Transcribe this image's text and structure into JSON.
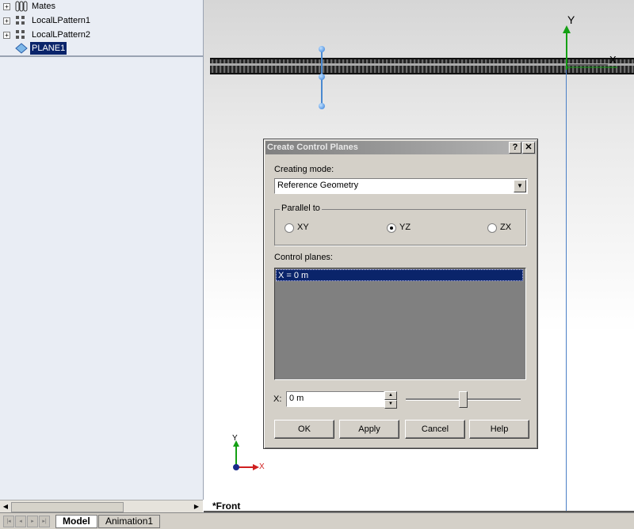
{
  "tree": {
    "items": [
      {
        "label": "Mates",
        "icon": "mates-icon",
        "expander": "+"
      },
      {
        "label": "LocalLPattern1",
        "icon": "linear-pattern-icon",
        "expander": "+"
      },
      {
        "label": "LocalLPattern2",
        "icon": "linear-pattern-icon",
        "expander": "+"
      },
      {
        "label": "PLANE1",
        "icon": "plane-icon",
        "expander": ""
      }
    ],
    "collapse_glyph": "◂"
  },
  "tabs": {
    "nav": [
      "|◂",
      "◂",
      "▸",
      "▸|"
    ],
    "items": [
      {
        "label": "Model",
        "active": true
      },
      {
        "label": "Animation1",
        "active": false
      }
    ]
  },
  "graphics": {
    "view_label": "*Front",
    "axis_y": "Y",
    "axis_x": "X",
    "colors": {
      "y_axis": "#14a014",
      "x_axis": "#d02020",
      "selection": "#0a246a",
      "handle": "#4a89d0"
    }
  },
  "dialog": {
    "title": "Create Control Planes",
    "help_glyph": "?",
    "close_glyph": "✕",
    "creating_mode_label": "Creating mode:",
    "creating_mode_value": "Reference Geometry",
    "parallel_to_label": "Parallel to",
    "parallel_options": [
      {
        "label": "XY",
        "selected": false
      },
      {
        "label": "YZ",
        "selected": true
      },
      {
        "label": "ZX",
        "selected": false
      }
    ],
    "control_planes_label": "Control planes:",
    "control_planes": [
      "X = 0 m"
    ],
    "x_label": "X:",
    "x_value": "0 m",
    "slider_level": 0.5,
    "buttons": {
      "ok": "OK",
      "apply": "Apply",
      "cancel": "Cancel",
      "help": "Help"
    }
  }
}
